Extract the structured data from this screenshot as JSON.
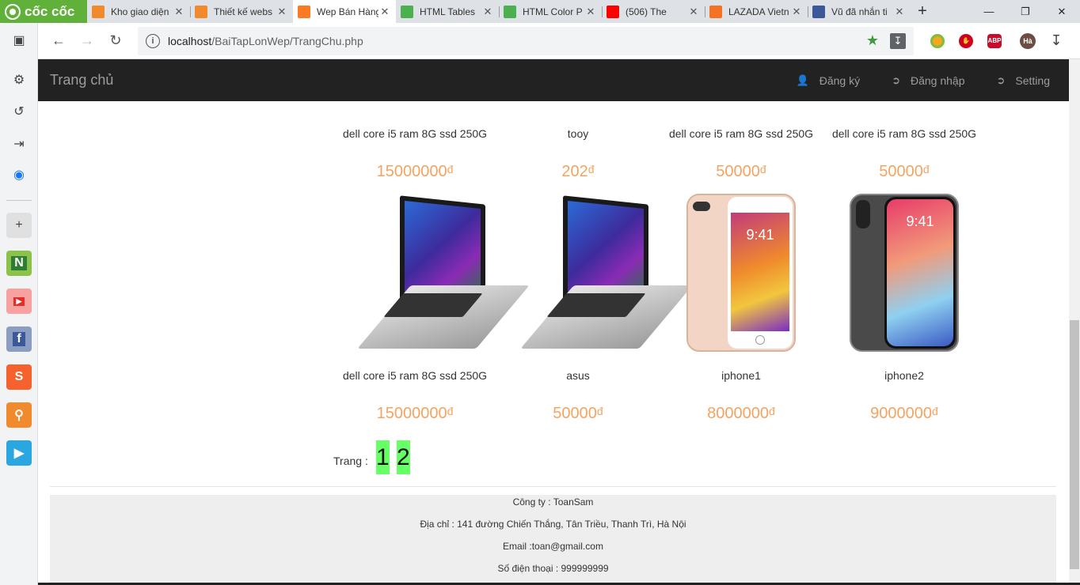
{
  "browser": {
    "brand": "cốc cốc",
    "tabs": [
      {
        "title": "Kho giao diện",
        "icon": "star-burst-icon",
        "color": "#f08a2c"
      },
      {
        "title": "Thiết kế webs",
        "icon": "star-burst-icon",
        "color": "#f08a2c"
      },
      {
        "title": "Wep Bán Hàng",
        "icon": "xampp-icon",
        "color": "#fb7a24",
        "active": true
      },
      {
        "title": "HTML Tables",
        "icon": "w3schools-icon",
        "color": "#4caf50"
      },
      {
        "title": "HTML Color P",
        "icon": "w3schools-icon",
        "color": "#4caf50"
      },
      {
        "title": "(506) The",
        "icon": "youtube-icon",
        "color": "#ff0000"
      },
      {
        "title": "LAZADA Vietn",
        "icon": "lazada-icon",
        "color": "#f57224"
      },
      {
        "title": "Vũ đã nhắn ti",
        "icon": "facebook-icon",
        "color": "#3b5998"
      }
    ],
    "url_host": "localhost",
    "url_path": "/BaiTapLonWep/TrangChu.php",
    "profile_initials": "Hà"
  },
  "navbar": {
    "brand": "Trang chủ",
    "links": [
      "Đăng ký",
      "Đăng nhập",
      "Setting"
    ]
  },
  "products_row1": [
    {
      "name": "dell core i5 ram 8G ssd 250G",
      "price": "15000000",
      "currency": "đ"
    },
    {
      "name": "tooy",
      "price": "202",
      "currency": "đ"
    },
    {
      "name": "dell core i5 ram 8G ssd 250G",
      "price": "50000",
      "currency": "đ"
    },
    {
      "name": "dell core i5 ram 8G ssd 250G",
      "price": "50000",
      "currency": "đ"
    }
  ],
  "products_row2": [
    {
      "name": "dell core i5 ram 8G ssd 250G",
      "price": "15000000",
      "currency": "đ",
      "image": "laptop"
    },
    {
      "name": "asus",
      "price": "50000",
      "currency": "đ",
      "image": "laptop"
    },
    {
      "name": "iphone1",
      "price": "8000000",
      "currency": "đ",
      "image": "phone-gold",
      "clock": "9:41"
    },
    {
      "name": "iphone2",
      "price": "9000000",
      "currency": "đ",
      "image": "phone-dark",
      "clock": "9:41"
    }
  ],
  "pagination": {
    "label": "Trang :",
    "pages": [
      "1",
      "2"
    ]
  },
  "footer": {
    "company": "Công ty : ToanSam",
    "address": "Địa chỉ : 141 đường Chiến Thắng, Tân Triều, Thanh Trì, Hà Nội",
    "email": "Email :toan@gmail.com",
    "phone": "Số điện thoại : 999999999"
  },
  "colors": {
    "price": "#f4a460",
    "pager_bg": "#66ff66",
    "navbar_bg": "#222222"
  }
}
